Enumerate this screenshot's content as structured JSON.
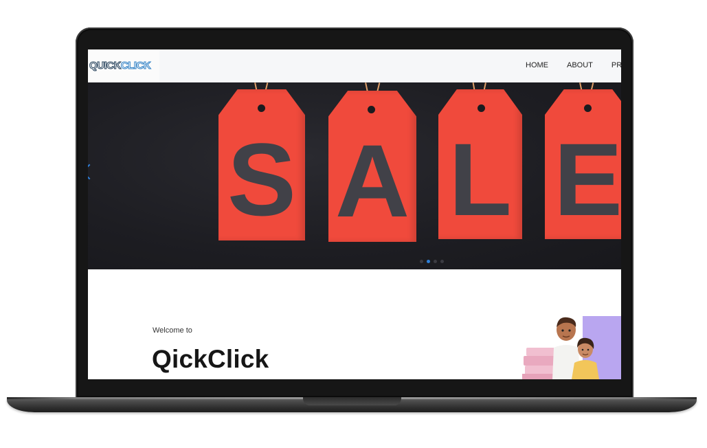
{
  "navbar": {
    "logo_part1": "QUICK",
    "logo_part2": "CLICK",
    "links": [
      "HOME",
      "ABOUT",
      "PRO"
    ]
  },
  "hero": {
    "tag_letters": [
      "S",
      "A",
      "L",
      "E"
    ],
    "carousel_dots": 4,
    "active_dot": 1
  },
  "intro": {
    "welcome_text": "Welcome to",
    "brand_name": "QickClick"
  },
  "colors": {
    "accent": "#2e7fd8",
    "tag_red": "#f04a3c",
    "hero_bg": "#1d1d22"
  }
}
